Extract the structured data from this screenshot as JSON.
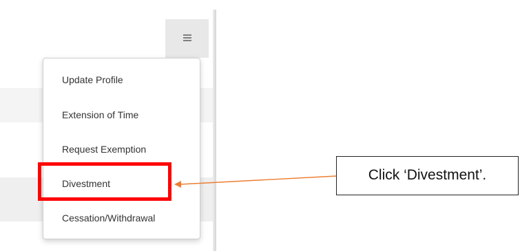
{
  "menu": {
    "toggle_icon": "hamburger-icon",
    "items": [
      "Update Profile",
      "Extension of Time",
      "Request Exemption",
      "Divestment",
      "Cessation/Withdrawal"
    ]
  },
  "annotation": {
    "callout_text": "Click ‘Divestment’.",
    "highlight_target": "Divestment",
    "highlight_color": "#ff0000",
    "arrow_color": "#ed7d31"
  }
}
